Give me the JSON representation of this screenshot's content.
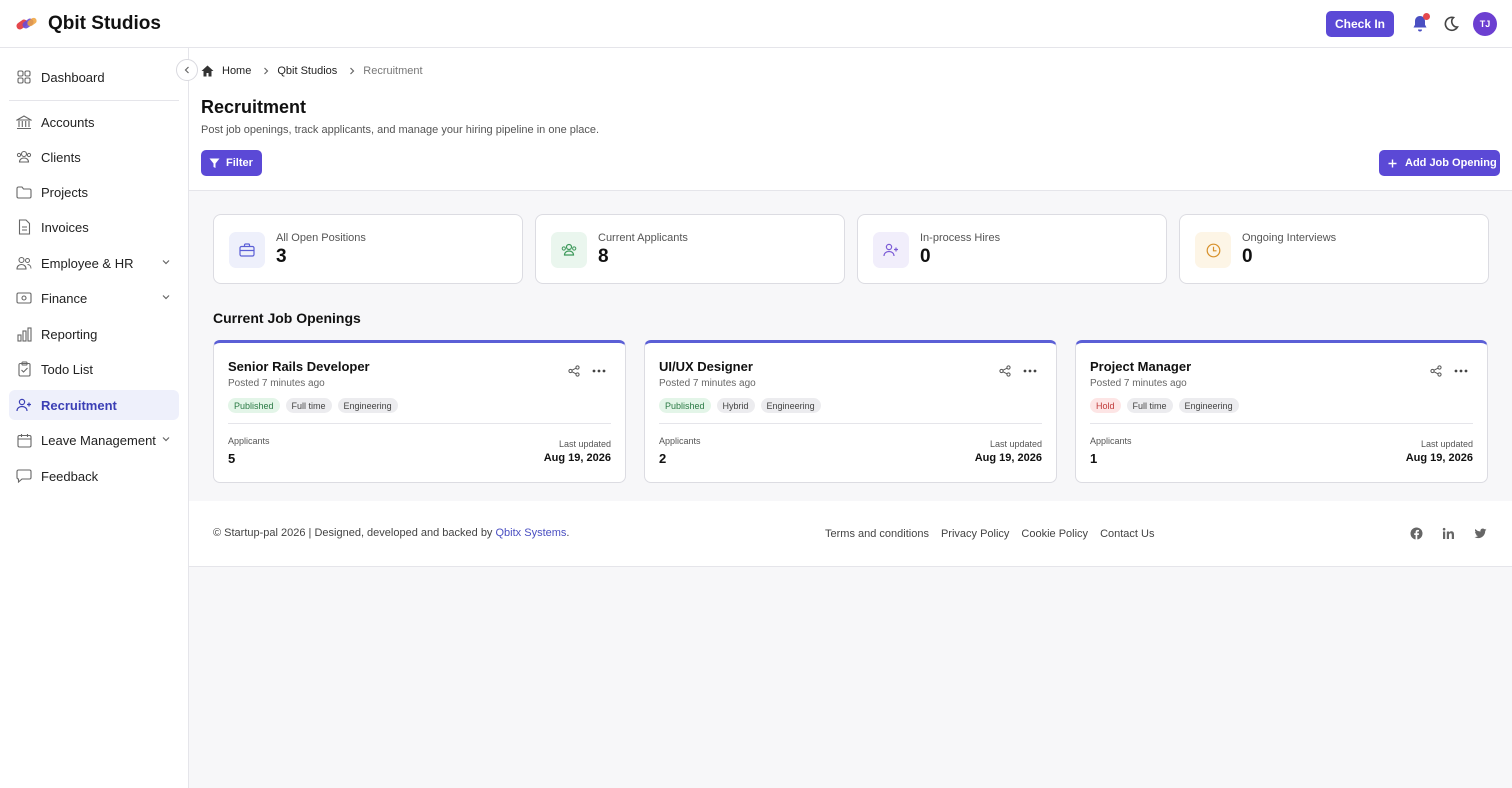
{
  "app": {
    "name": "Qbit Studios"
  },
  "topbar": {
    "checkin_label": "Check In",
    "avatar_initials": "TJ",
    "bell_icon": "bell-icon",
    "theme_icon": "moon-icon"
  },
  "sidebar": {
    "items": [
      {
        "label": "Dashboard",
        "icon": "grid-icon"
      },
      {
        "label": "Accounts",
        "icon": "bank-icon"
      },
      {
        "label": "Clients",
        "icon": "users-icon"
      },
      {
        "label": "Projects",
        "icon": "folder-icon"
      },
      {
        "label": "Invoices",
        "icon": "file-icon"
      },
      {
        "label": "Employee & HR",
        "icon": "people-icon"
      },
      {
        "label": "Finance",
        "icon": "money-icon"
      },
      {
        "label": "Reporting",
        "icon": "chart-icon"
      },
      {
        "label": "Todo List",
        "icon": "clipboard-icon"
      },
      {
        "label": "Recruitment",
        "icon": "user-plus-icon"
      },
      {
        "label": "Leave Management",
        "icon": "calendar-icon"
      },
      {
        "label": "Feedback",
        "icon": "chat-icon"
      }
    ]
  },
  "breadcrumb": {
    "home": "Home",
    "company": "Qbit Studios",
    "current": "Recruitment"
  },
  "page": {
    "title": "Recruitment",
    "subtitle": "Post job openings, track applicants, and manage your hiring pipeline in one place.",
    "filter_label": "Filter",
    "add_label": "Add Job Opening"
  },
  "stats": [
    {
      "label": "All Open Positions",
      "value": "3",
      "color": "#5b5fd6",
      "bg": "#eef0fb"
    },
    {
      "label": "Current Applicants",
      "value": "8",
      "color": "#3f9a5c",
      "bg": "#eaf6ee"
    },
    {
      "label": "In-process Hires",
      "value": "0",
      "color": "#7b5bd6",
      "bg": "#f1eefb"
    },
    {
      "label": "Ongoing Interviews",
      "value": "0",
      "color": "#d7902a",
      "bg": "#fdf5e6"
    }
  ],
  "section_title": "Current Job Openings",
  "jobs": [
    {
      "title": "Senior Rails Developer",
      "posted": "Posted 7 minutes ago",
      "status": "Published",
      "type": "Full time",
      "dept": "Engineering",
      "applicants_label": "Applicants",
      "applicants": "5",
      "updated_label": "Last updated",
      "updated": "Aug 19, 2026"
    },
    {
      "title": "UI/UX Designer",
      "posted": "Posted 7 minutes ago",
      "status": "Published",
      "type": "Hybrid",
      "dept": "Engineering",
      "applicants_label": "Applicants",
      "applicants": "2",
      "updated_label": "Last updated",
      "updated": "Aug 19, 2026"
    },
    {
      "title": "Project Manager",
      "posted": "Posted 7 minutes ago",
      "status": "Hold",
      "type": "Full time",
      "dept": "Engineering",
      "applicants_label": "Applicants",
      "applicants": "1",
      "updated_label": "Last updated",
      "updated": "Aug 19, 2026"
    }
  ],
  "footer": {
    "copy": "© Startup-pal 2026 | Designed, developed and backed by ",
    "company_link": "Qbitx Systems",
    "period": ".",
    "links": [
      "Terms and conditions",
      "Privacy Policy",
      "Cookie Policy",
      "Contact Us"
    ]
  }
}
